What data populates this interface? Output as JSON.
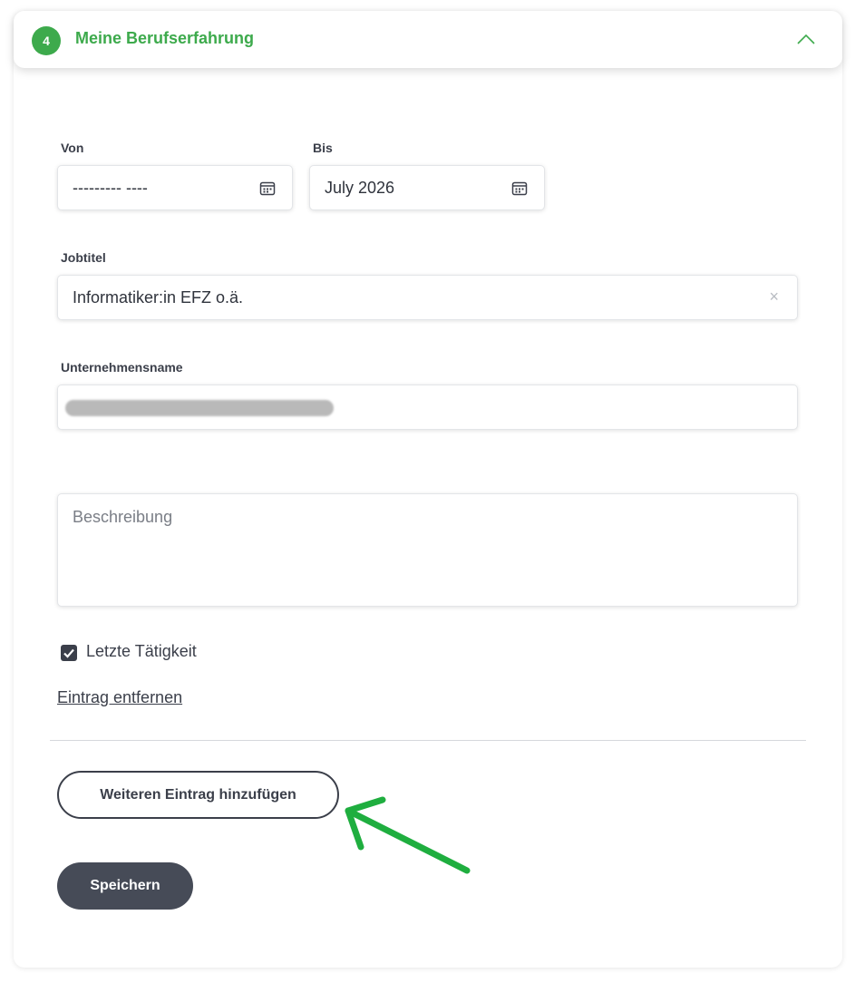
{
  "section": {
    "step_number": "4",
    "title": "Meine Berufserfahrung",
    "accent_color": "#3daa4c",
    "collapse_icon": "chevron-up-icon"
  },
  "form": {
    "from_label": "Von",
    "from_value": "--------- ----",
    "to_label": "Bis",
    "to_value": "July 2026",
    "calendar_icon": "calendar-icon",
    "job_title_label": "Jobtitel",
    "job_title_value": "Informatiker:in EFZ o.ä.",
    "clear_icon": "×",
    "company_label": "Unternehmensname",
    "description_placeholder": "Beschreibung",
    "last_job_label": "Letzte Tätigkeit",
    "last_job_checked": true,
    "remove_link": "Eintrag entfernen"
  },
  "actions": {
    "add_entry": "Weiteren Eintrag hinzufügen",
    "save": "Speichern"
  },
  "annotation": {
    "arrow_color": "#1fae3f"
  }
}
